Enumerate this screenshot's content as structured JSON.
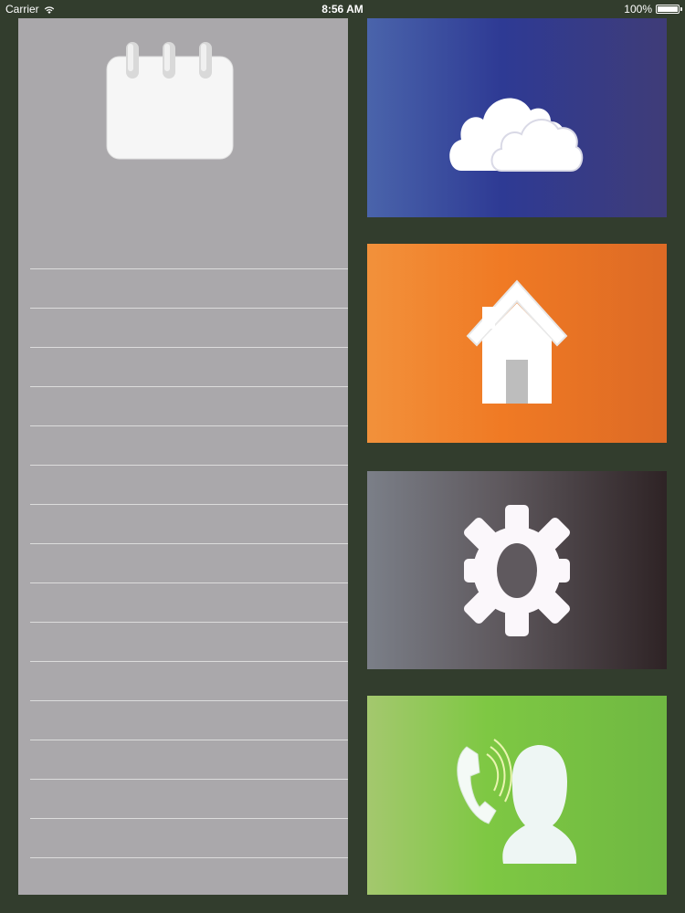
{
  "status_bar": {
    "carrier": "Carrier",
    "time": "8:56 AM",
    "battery": "100%"
  },
  "colors": {
    "background": "#323d2d",
    "notes_panel": "#aaa8ab",
    "cloud_tile": "#2e3a94",
    "home_tile": "#f07a24",
    "settings_tile": "#5e585d",
    "contact_tile": "#7ec843"
  },
  "tiles": [
    {
      "name": "cloud",
      "icon": "cloud-icon"
    },
    {
      "name": "home",
      "icon": "home-icon"
    },
    {
      "name": "settings",
      "icon": "gear-icon"
    },
    {
      "name": "contact",
      "icon": "phone-contact-icon"
    }
  ],
  "notes_panel": {
    "icon": "calendar-icon"
  }
}
